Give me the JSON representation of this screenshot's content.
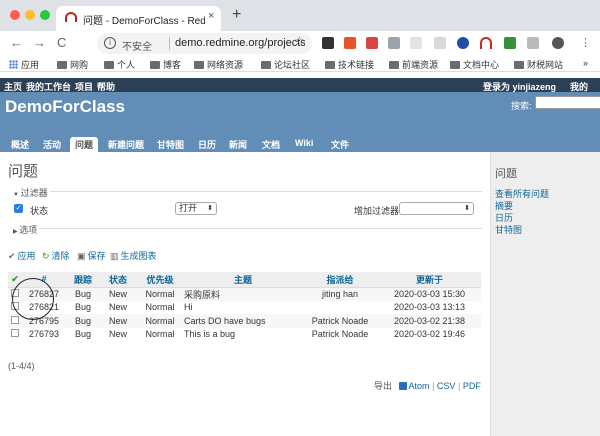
{
  "browser": {
    "tab_title": "问题 - DemoForClass - Redmine",
    "tab_close": "×",
    "new_tab": "+",
    "back": "←",
    "forward": "→",
    "reload": "C",
    "insecure_label": "不安全",
    "url": "demo.redmine.org/projects/",
    "bookmark_star": "☆",
    "bookmarks": [
      "应用",
      "网购",
      "个人",
      "博客",
      "网络资源",
      "论坛社区",
      "技术链接",
      "前端资源",
      "文档中心",
      "财税网站"
    ],
    "bookmarks_more": "»"
  },
  "top_menu": {
    "items": [
      "主页",
      "我的工作台",
      "项目",
      "帮助"
    ],
    "logged_in": "登录为 yinjiazeng",
    "my_account": "我的"
  },
  "header": {
    "project_title": "DemoForClass",
    "search_label": "搜索:"
  },
  "main_tabs": [
    "概述",
    "活动",
    "问题",
    "新建问题",
    "甘特图",
    "日历",
    "新闻",
    "文档",
    "Wiki",
    "文件"
  ],
  "page_title": "问题",
  "filters": {
    "legend": "过滤器",
    "status_label": "状态",
    "operator": "打开",
    "add_filter_label": "增加过滤器",
    "options_legend": "选项"
  },
  "actions": {
    "apply": "应用",
    "clear": "清除",
    "save": "保存",
    "chart": "生成图表"
  },
  "table": {
    "headers": [
      "#",
      "跟踪",
      "状态",
      "优先级",
      "主题",
      "指派给",
      "更新于"
    ],
    "rows": [
      {
        "id": "276827",
        "tracker": "Bug",
        "status": "New",
        "priority": "Normal",
        "subject": "采购原料",
        "assignee": "jiting han",
        "updated": "2020-03-03 15:30"
      },
      {
        "id": "276821",
        "tracker": "Bug",
        "status": "New",
        "priority": "Normal",
        "subject": "Hi",
        "assignee": "",
        "updated": "2020-03-03 13:13"
      },
      {
        "id": "276795",
        "tracker": "Bug",
        "status": "New",
        "priority": "Normal",
        "subject": "Carts DO have bugs",
        "assignee": "Patrick Noade",
        "updated": "2020-03-02 21:38"
      },
      {
        "id": "276793",
        "tracker": "Bug",
        "status": "New",
        "priority": "Normal",
        "subject": "This is a bug",
        "assignee": "Patrick Noade",
        "updated": "2020-03-02 19:46"
      }
    ]
  },
  "pagination": "(1-4/4)",
  "export": {
    "label": "导出",
    "formats": [
      "Atom",
      "CSV",
      "PDF"
    ],
    "separator": "|"
  },
  "sidebar": {
    "title": "问题",
    "links": [
      "查看所有问题",
      "摘要",
      "日历",
      "甘特图"
    ]
  }
}
